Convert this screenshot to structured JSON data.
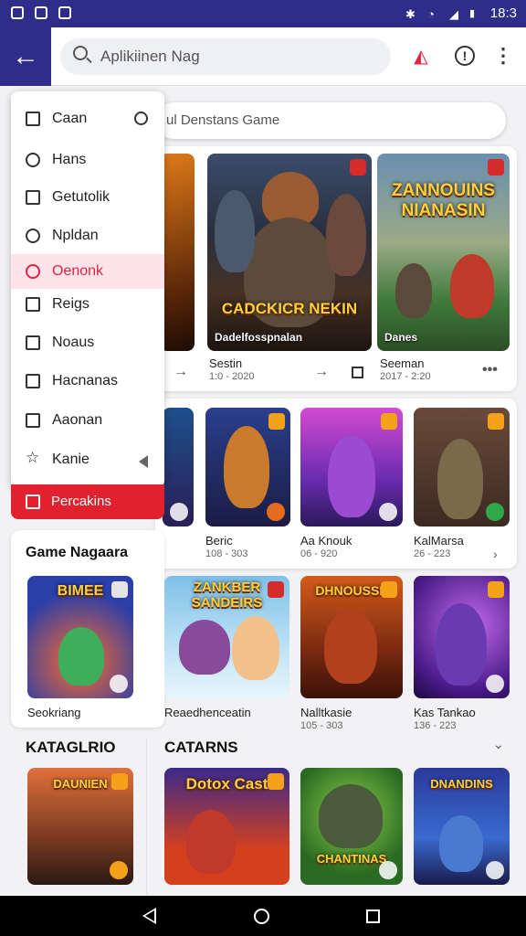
{
  "status_bar": {
    "time": "18:3"
  },
  "app_bar": {
    "search_text": "Aplikiinen Nag",
    "icons": [
      "back-arrow-icon",
      "search-icon",
      "alert-icon",
      "info-icon",
      "more-vert-icon"
    ]
  },
  "content_search": {
    "text": "ul Denstans Game"
  },
  "featured": [
    {
      "caption": "Dadelfosspnalan",
      "title": "",
      "sub": ""
    },
    {
      "caption": "CADCKICR NEKIN",
      "title": "Sestin",
      "sub": "1:0 - 2020"
    },
    {
      "caption": "Danes",
      "logo": "ZANNOUINS NIANASIN",
      "title": "Seeman",
      "sub": "2017 - 2:20"
    }
  ],
  "grid_row1": [
    {
      "title": "",
      "sub": ""
    },
    {
      "title": "Beric",
      "sub": "108 - 303"
    },
    {
      "title": "Aa Knouk",
      "sub": "06 - 920"
    },
    {
      "title": "KalMarsa",
      "sub": "26 - 223"
    }
  ],
  "menu": {
    "items": [
      {
        "label": "Caan"
      },
      {
        "label": "Hans"
      },
      {
        "label": "Getutolik"
      },
      {
        "label": "Npldan"
      },
      {
        "label": "Oenonk"
      },
      {
        "label": "Reigs"
      },
      {
        "label": "Noaus"
      },
      {
        "label": "Hacnanas"
      },
      {
        "label": "Aaonan"
      },
      {
        "label": "Kanie"
      }
    ],
    "primary_button": "Percakins"
  },
  "game_section": {
    "title": "Game Nagaara",
    "cards": [
      {
        "title": "Seokriang",
        "logo": "BIMEE"
      },
      {
        "title": "Reaedhenceatin",
        "logo": "ZANKBER SANDEIRS"
      },
      {
        "title": "Nalltkasie",
        "sub": "105 - 303",
        "logo": "DHNOUSSE"
      },
      {
        "title": "Kas Tankao",
        "sub": "136 - 223"
      }
    ]
  },
  "categories": {
    "left_title": "KATAGLRIO",
    "right_title": "CATARNS",
    "cards": [
      {
        "logo": "DAUNIEN"
      },
      {
        "logo": "Dotox Cast"
      },
      {
        "logo": "CHANTINAS"
      },
      {
        "logo": "DNANDINS"
      }
    ]
  },
  "colors": {
    "accent": "#2e2e8a",
    "danger": "#e2212e",
    "active_bg": "#ffe3ea"
  }
}
